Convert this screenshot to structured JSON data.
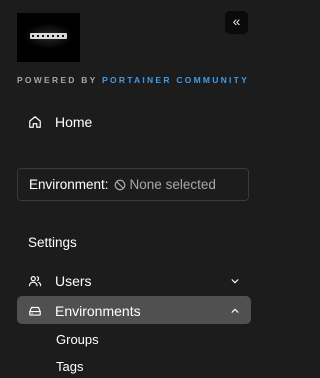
{
  "header": {
    "logo_text": "CASCEN",
    "collapse_icon": "chevrons-left-icon",
    "powered_by": "POWERED BY",
    "brand": "PORTAINER COMMUNITY",
    "colors": {
      "brand": "#3f9ce8",
      "background": "#1c1c1c"
    }
  },
  "nav": {
    "home": {
      "label": "Home",
      "icon": "home-icon"
    }
  },
  "environment": {
    "label": "Environment:",
    "value": "None selected",
    "icon": "ban-icon"
  },
  "settings": {
    "title": "Settings",
    "items": [
      {
        "label": "Users",
        "icon": "users-icon",
        "expanded": false
      },
      {
        "label": "Environments",
        "icon": "hard-drive-icon",
        "expanded": true,
        "active": true,
        "children": [
          {
            "label": "Groups"
          },
          {
            "label": "Tags"
          }
        ]
      }
    ]
  }
}
